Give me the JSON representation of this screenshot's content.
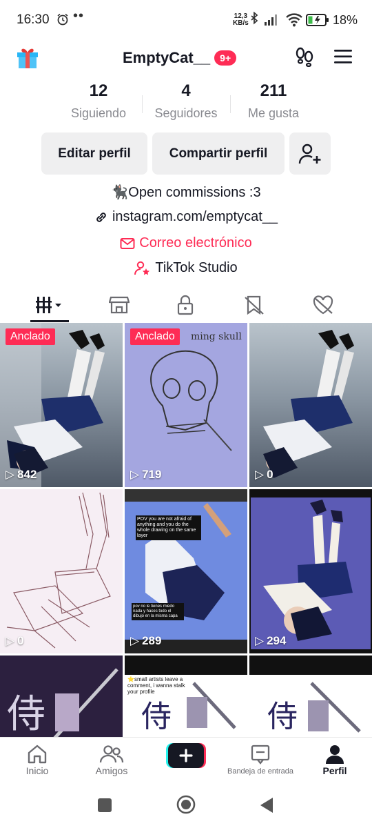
{
  "status_bar": {
    "time": "16:30",
    "dots": "••",
    "net_speed_value": "12,3",
    "net_speed_unit": "KB/s",
    "battery_pct": "18%"
  },
  "header": {
    "username": "EmptyCat__",
    "notif_badge": "9+"
  },
  "stats": [
    {
      "value": "12",
      "label": "Siguiendo"
    },
    {
      "value": "4",
      "label": "Seguidores"
    },
    {
      "value": "211",
      "label": "Me gusta"
    }
  ],
  "actions": {
    "edit": "Editar perfil",
    "share": "Compartir perfil"
  },
  "bio": {
    "line1": "🐈‍⬛Open commissions :3",
    "link": "instagram.com/emptycat__",
    "email": "Correo electrónico",
    "studio": "TikTok Studio"
  },
  "videos": [
    {
      "pinned": "Anclado",
      "views": "842"
    },
    {
      "pinned": "Anclado",
      "views": "719",
      "caption": "ming skull"
    },
    {
      "views": "0"
    },
    {
      "views": "0"
    },
    {
      "views": "289",
      "overlay_top": "POV you are not afraid of anything and you do the whole drawing on the same layer",
      "overlay_mid": "pov no le tienes miedo nada y haces todo el dibujo en la misma capa"
    },
    {
      "views": "294"
    },
    {
      "kanji": "侍"
    },
    {
      "kanji": "侍",
      "caption": "⭐small artists leave a comment, i wanna stalk your profile"
    },
    {
      "kanji": "侍"
    }
  ],
  "bottom_nav": {
    "home": "Inicio",
    "friends": "Amigos",
    "inbox": "Bandeja de entrada",
    "profile": "Perfil"
  },
  "colors": {
    "accent": "#fe2c55",
    "text": "#161823",
    "muted": "#8a8b91",
    "button_bg": "#efeff0"
  }
}
